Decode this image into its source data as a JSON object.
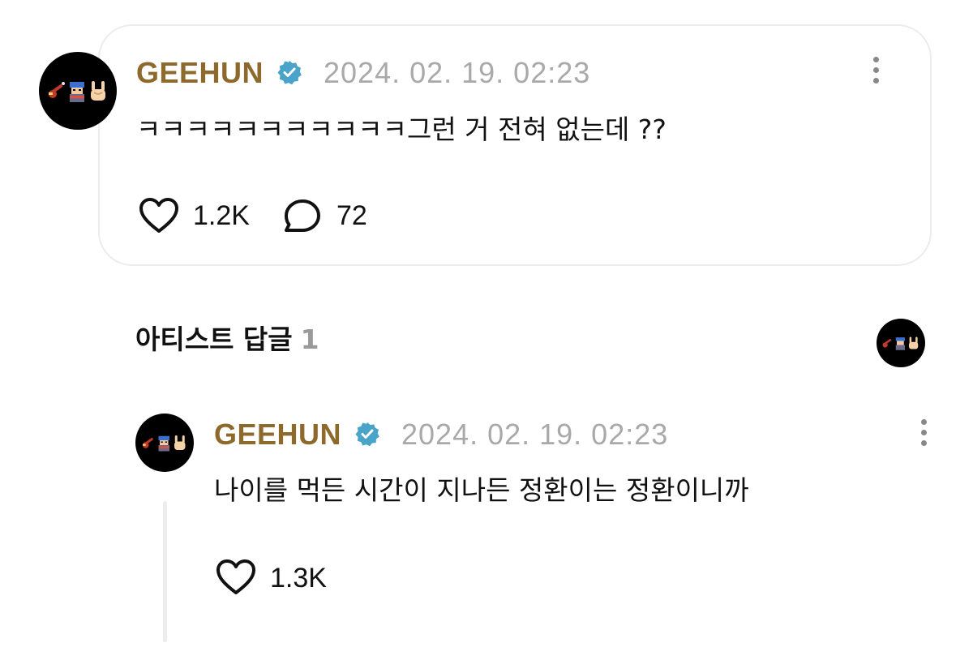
{
  "colors": {
    "name": "#8d6a2b",
    "verified": "#4aa3c9",
    "muted": "#a9a9a9",
    "text": "#111111",
    "card_border": "#ececec"
  },
  "post": {
    "author": "GEEHUN",
    "avatar_icons": [
      "guitar-emoji",
      "pixel-character-emoji",
      "rock-hand-emoji"
    ],
    "verified_icon": "verified-badge-icon",
    "timestamp": "2024. 02. 19. 02:23",
    "text": "ㅋㅋㅋㅋㅋㅋㅋㅋㅋㅋㅋ그런 거 전혀 없는데 ??",
    "likes": "1.2K",
    "comments": "72"
  },
  "artist_replies": {
    "title": "아티스트 답글",
    "count": "1"
  },
  "reply": {
    "author": "GEEHUN",
    "timestamp": "2024. 02. 19. 02:23",
    "text": "나이를 먹든 시간이 지나든 정환이는 정환이니까",
    "likes": "1.3K"
  }
}
